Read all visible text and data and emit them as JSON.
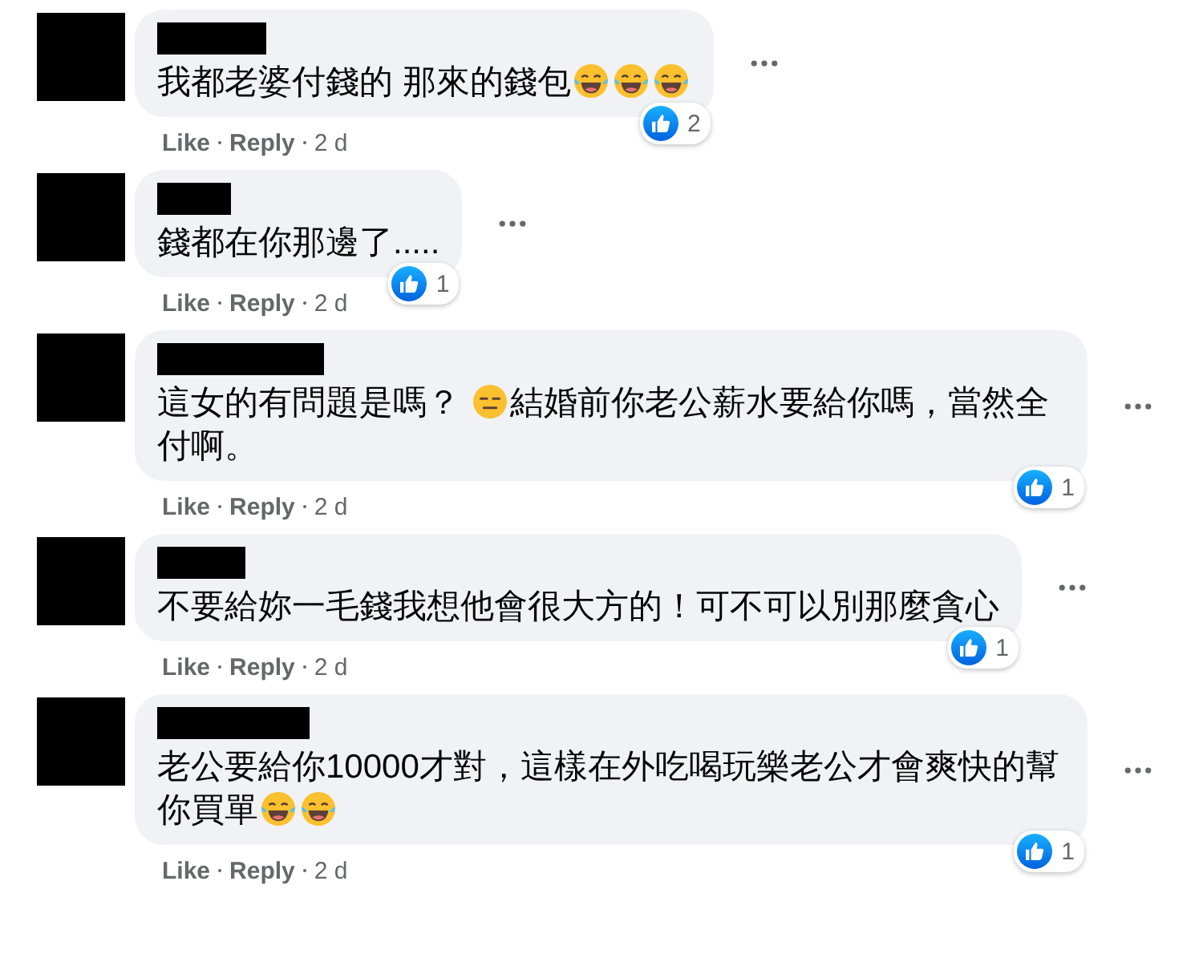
{
  "comments": [
    {
      "parts": [
        {
          "kind": "text",
          "text": "我都老婆付錢的 那來的錢包"
        },
        {
          "kind": "laughing_emoji"
        },
        {
          "kind": "laughing_emoji"
        },
        {
          "kind": "laughing_emoji"
        }
      ],
      "reaction_count": "2",
      "like": "Like",
      "reply": "Reply",
      "time": "2 d"
    },
    {
      "parts": [
        {
          "kind": "text",
          "text": "錢都在你那邊了....."
        }
      ],
      "reaction_count": "1",
      "like": "Like",
      "reply": "Reply",
      "time": "2 d"
    },
    {
      "parts": [
        {
          "kind": "text",
          "text": "這女的有問題是嗎？ "
        },
        {
          "kind": "expressionless_emoji"
        },
        {
          "kind": "text",
          "text": "結婚前你老公薪水要給你嗎，當然全付啊。"
        }
      ],
      "reaction_count": "1",
      "like": "Like",
      "reply": "Reply",
      "time": "2 d"
    },
    {
      "parts": [
        {
          "kind": "text",
          "text": "不要給妳一毛錢我想他會很大方的！可不可以別那麼貪心"
        }
      ],
      "reaction_count": "1",
      "like": "Like",
      "reply": "Reply",
      "time": "2 d"
    },
    {
      "parts": [
        {
          "kind": "text",
          "text": "老公要給你10000才對，這樣在外吃喝玩樂老公才會爽快的幫你買單"
        },
        {
          "kind": "laughing_emoji"
        },
        {
          "kind": "laughing_emoji"
        }
      ],
      "reaction_count": "1",
      "like": "Like",
      "reply": "Reply",
      "time": "2 d"
    }
  ]
}
